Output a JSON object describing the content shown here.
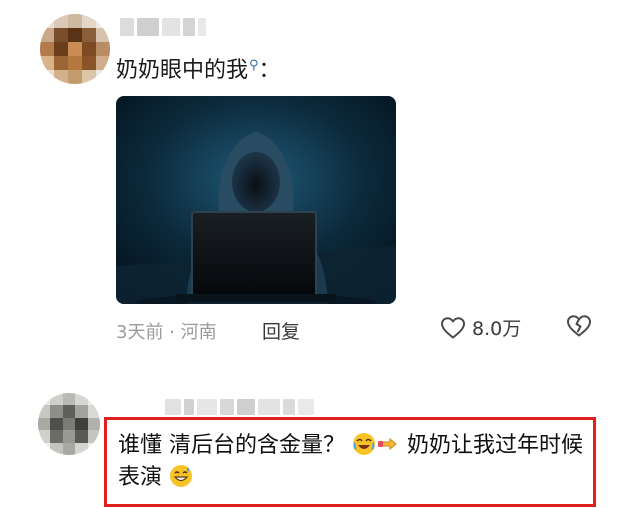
{
  "comment1": {
    "text": "奶奶眼中的我",
    "search_glyph": "⚲",
    "suffix": "：",
    "meta": "3天前 · 河南",
    "reply_label": "回复",
    "like_count": "8.0万",
    "image_description": "hooded figure at laptop"
  },
  "comment2": {
    "text_part1": "谁懂 清后台的含金量？",
    "text_part2": " 奶奶让我过年时候表演"
  },
  "icons": {
    "like": "heart-outline-icon",
    "dislike": "broken-heart-icon",
    "emoji_laugh": "rofl-emoji-icon",
    "emoji_point": "pointing-hand-emoji-icon",
    "emoji_sweat": "grinning-sweat-emoji-icon"
  },
  "colors": {
    "highlight_border": "#e0201c",
    "meta_text": "#9a9a9a",
    "link_blue": "#3c6ea6"
  }
}
